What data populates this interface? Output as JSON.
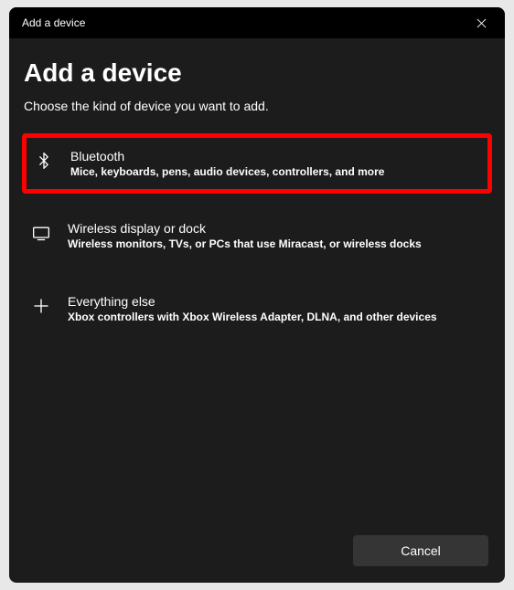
{
  "titlebar": {
    "title": "Add a device"
  },
  "header": {
    "heading": "Add a device",
    "subtitle": "Choose the kind of device you want to add."
  },
  "options": {
    "bluetooth": {
      "title": "Bluetooth",
      "description": "Mice, keyboards, pens, audio devices, controllers, and more"
    },
    "wireless": {
      "title": "Wireless display or dock",
      "description": "Wireless monitors, TVs, or PCs that use Miracast, or wireless docks"
    },
    "everything": {
      "title": "Everything else",
      "description": "Xbox controllers with Xbox Wireless Adapter, DLNA, and other devices"
    }
  },
  "footer": {
    "cancel_label": "Cancel"
  }
}
